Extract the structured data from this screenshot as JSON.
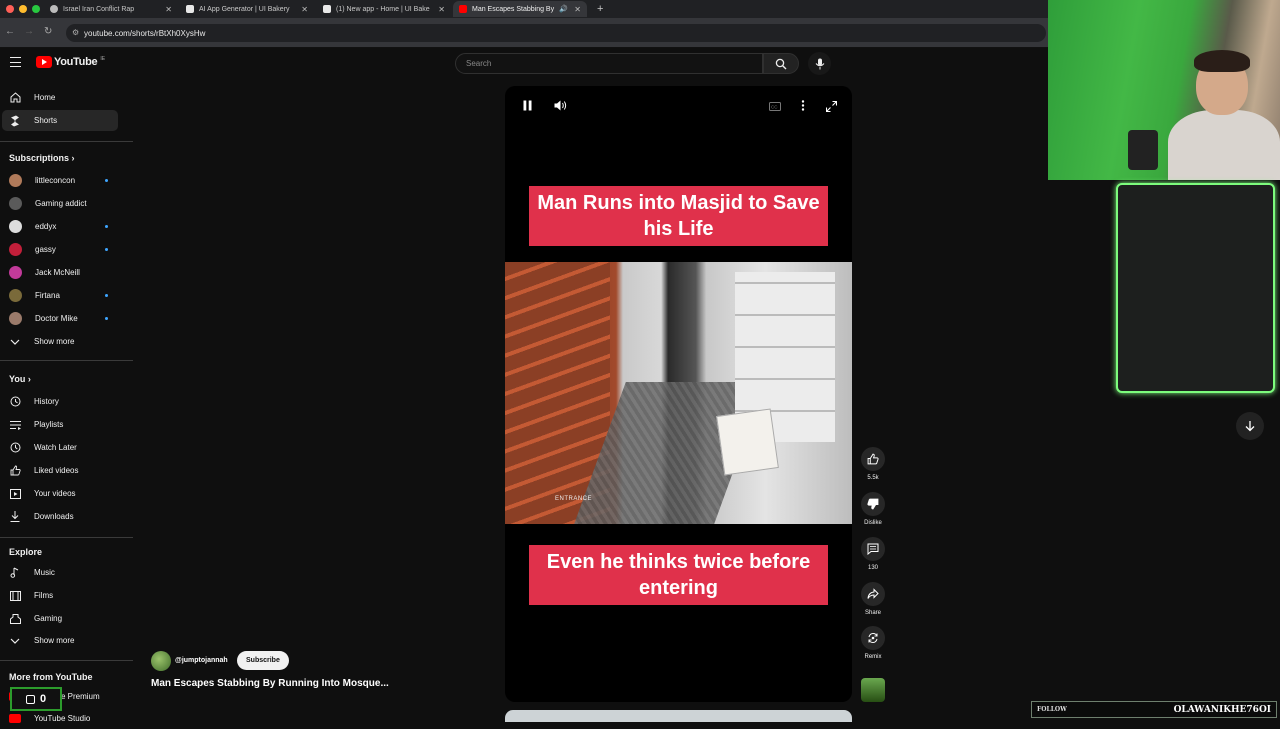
{
  "browser": {
    "tabs": [
      {
        "title": "Israel Iran Conflict Rap",
        "color": "#bbbbbb"
      },
      {
        "title": "AI App Generator | UI Bakery",
        "color": "#e8e8e8"
      },
      {
        "title": "(1) New app - Home | UI Bake",
        "color": "#e8e8e8"
      },
      {
        "title": "Man Escapes Stabbing By",
        "color": "#ff0000"
      }
    ],
    "new_tab": "+",
    "url": "youtube.com/shorts/rBtXh0XysHw"
  },
  "header": {
    "logo_text": "YouTube",
    "logo_region": "IE",
    "search_placeholder": "Search"
  },
  "sidebar": {
    "main": [
      {
        "label": "Home",
        "icon": "home-icon"
      },
      {
        "label": "Shorts",
        "icon": "shorts-icon"
      }
    ],
    "subscriptions_title": "Subscriptions",
    "subscriptions": [
      {
        "label": "littleconcon",
        "color": "#b07a5a",
        "dot": true
      },
      {
        "label": "Gaming addict",
        "color": "#5a5a5a",
        "dot": false
      },
      {
        "label": "eddyx",
        "color": "#222",
        "dot": true
      },
      {
        "label": "gassy",
        "color": "#c21f3a",
        "dot": true
      },
      {
        "label": "Jack McNeill",
        "color": "#c23a9a",
        "dot": false
      },
      {
        "label": "Firtana",
        "color": "#7a6a3a",
        "dot": true
      },
      {
        "label": "Doctor Mike",
        "color": "#9a7a6a",
        "dot": true
      }
    ],
    "show_more": "Show more",
    "you_title": "You",
    "you": [
      {
        "label": "History",
        "icon": "history-icon"
      },
      {
        "label": "Playlists",
        "icon": "playlists-icon"
      },
      {
        "label": "Watch Later",
        "icon": "watch-later-icon"
      },
      {
        "label": "Liked videos",
        "icon": "like-icon"
      },
      {
        "label": "Your videos",
        "icon": "your-videos-icon"
      },
      {
        "label": "Downloads",
        "icon": "download-icon"
      }
    ],
    "explore_title": "Explore",
    "explore": [
      {
        "label": "Music",
        "icon": "music-icon"
      },
      {
        "label": "Films",
        "icon": "films-icon"
      },
      {
        "label": "Gaming",
        "icon": "gaming-icon"
      }
    ],
    "show_more_2": "Show more",
    "more_title": "More from YouTube",
    "more": [
      {
        "label": "YouTube Premium"
      },
      {
        "label": "YouTube Studio"
      }
    ]
  },
  "video": {
    "caption_top": "Man Runs into Masjid to Save his Life",
    "caption_bottom": "Even he thinks twice before entering",
    "frame_tag": "ENTRANCE",
    "channel": "@jumptojannah",
    "subscribe": "Subscribe",
    "title": "Man Escapes Stabbing By Running Into Mosque..."
  },
  "actions": {
    "like_count": "5.5k",
    "dislike": "Dislike",
    "comments": "130",
    "share": "Share",
    "remix": "Remix"
  },
  "overlay": {
    "follow_label": "FOLLOW",
    "streamer": "OLAWANIKHE76OI",
    "counter": "0"
  },
  "colors": {
    "accent": "#ff0000",
    "caption_bg": "#e0314b",
    "overlay_green": "#7dfc7d"
  }
}
